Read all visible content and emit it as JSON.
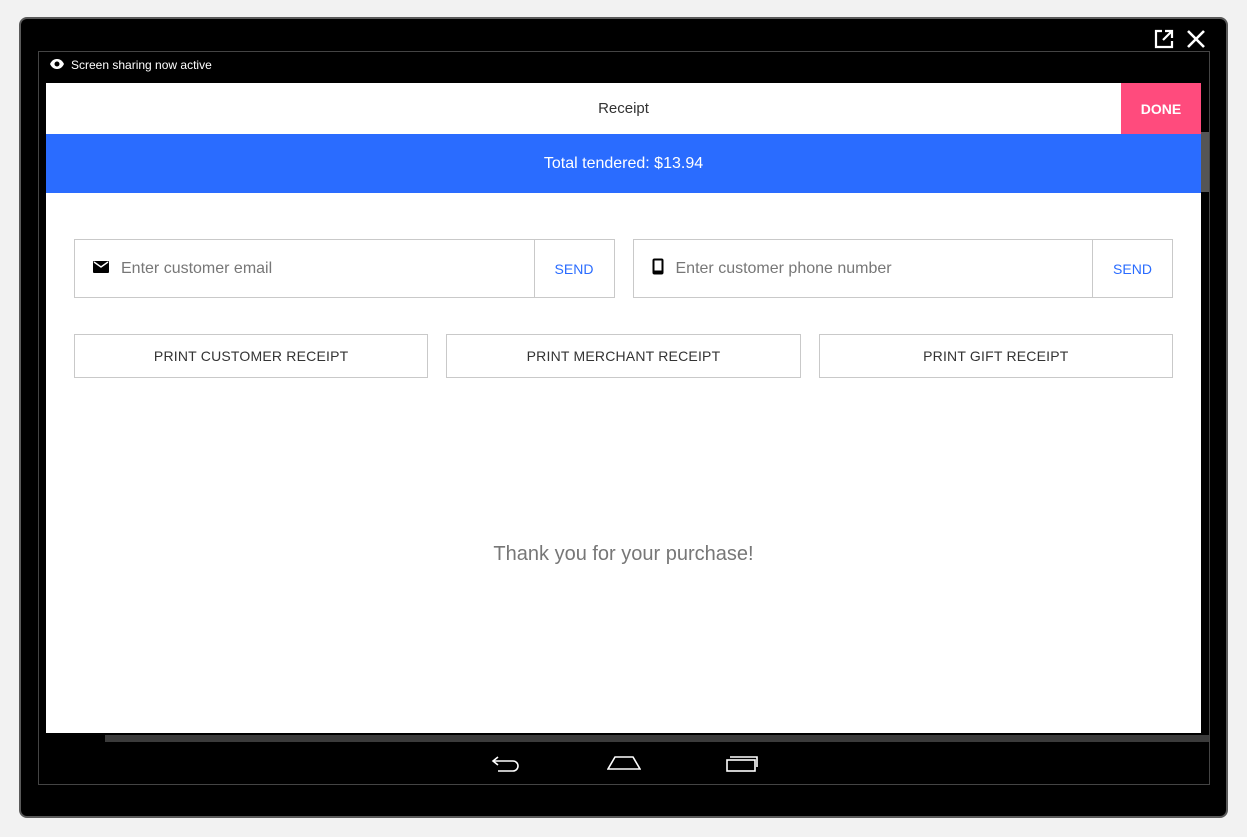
{
  "share_bar": {
    "text": "Screen sharing now active"
  },
  "window_controls": {
    "popout_icon": "popout-icon",
    "close_icon": "close-icon"
  },
  "dialog": {
    "title": "Receipt",
    "done_label": "DONE",
    "total_tendered": "Total tendered: $13.94",
    "email": {
      "placeholder": "Enter customer email",
      "send_label": "SEND",
      "icon": "mail-icon"
    },
    "phone": {
      "placeholder": "Enter customer phone number",
      "send_label": "SEND",
      "icon": "phone-icon"
    },
    "print_buttons": [
      "PRINT CUSTOMER RECEIPT",
      "PRINT MERCHANT RECEIPT",
      "PRINT GIFT RECEIPT"
    ],
    "thank_you": "Thank you for your purchase!"
  },
  "navbar": {
    "back_icon": "back-icon",
    "home_icon": "home-icon",
    "recents_icon": "recents-icon"
  },
  "colors": {
    "accent": "#2a6cff",
    "done": "#ff4b7d"
  }
}
